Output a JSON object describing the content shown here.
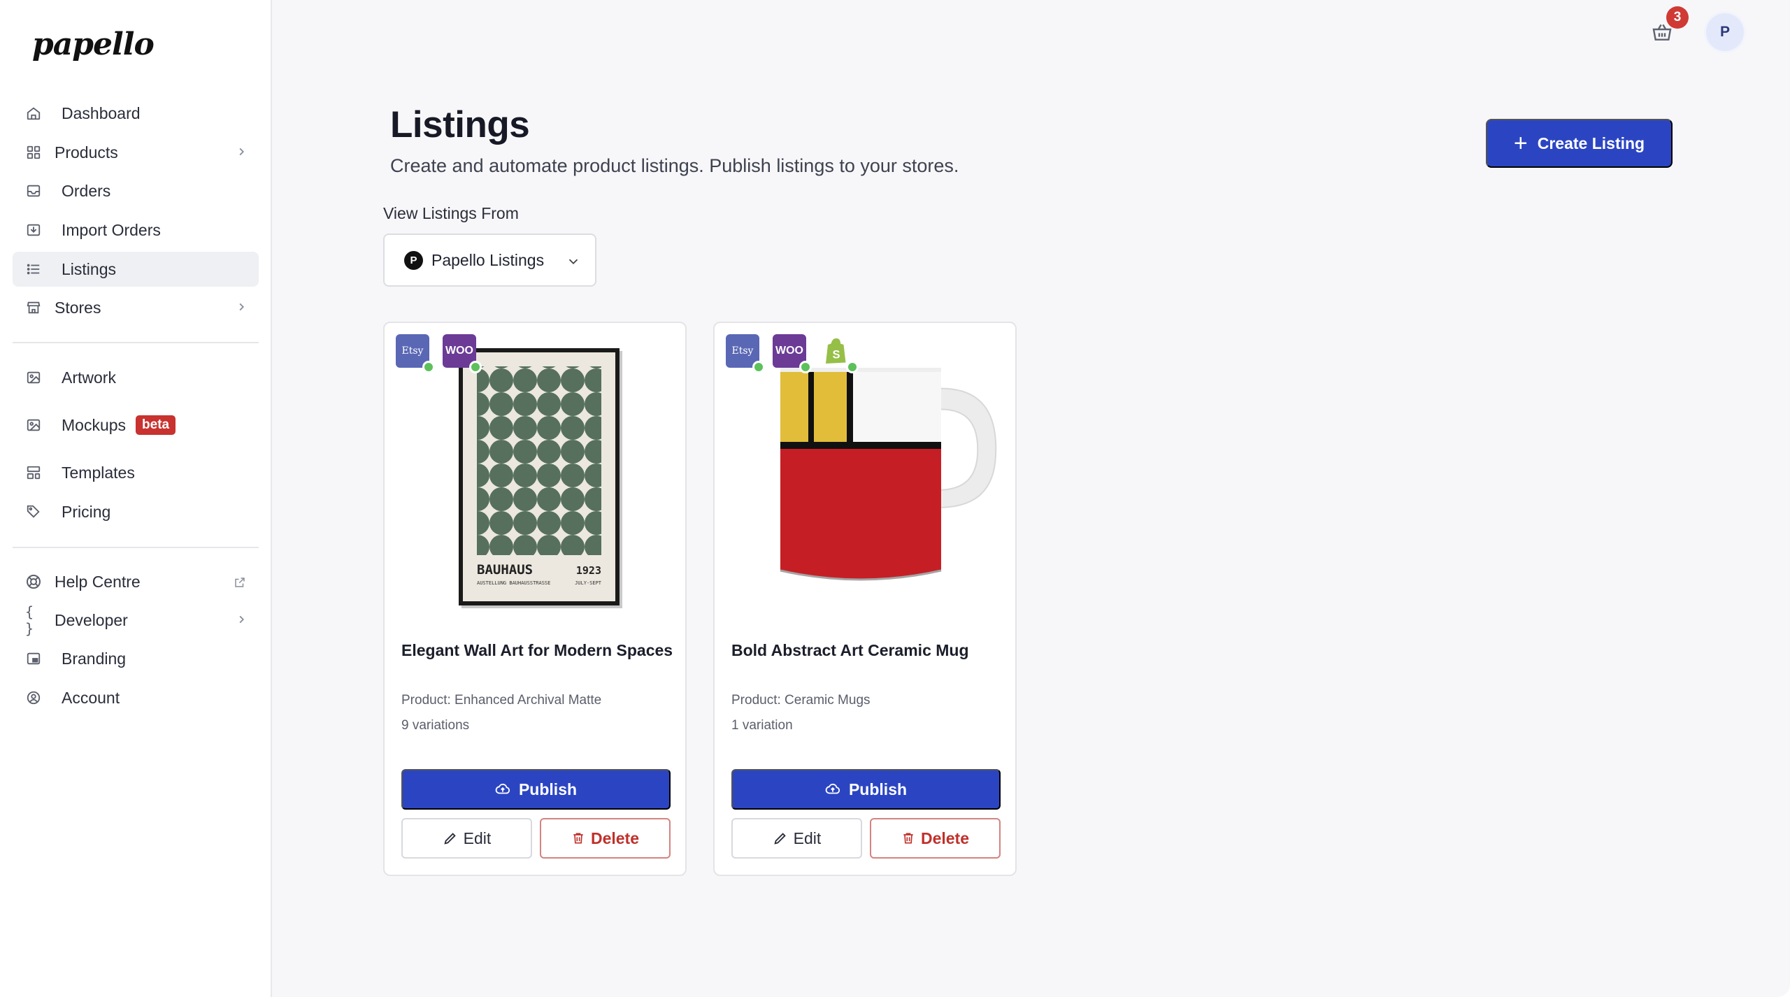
{
  "brand": {
    "logo": "papello"
  },
  "sidebar": {
    "items": [
      {
        "label": "Dashboard"
      },
      {
        "label": "Products"
      },
      {
        "label": "Orders"
      },
      {
        "label": "Import Orders"
      },
      {
        "label": "Listings"
      },
      {
        "label": "Stores"
      },
      {
        "label": "Artwork"
      },
      {
        "label": "Mockups",
        "badge": "beta"
      },
      {
        "label": "Templates"
      },
      {
        "label": "Pricing"
      },
      {
        "label": "Help Centre"
      },
      {
        "label": "Developer"
      },
      {
        "label": "Branding"
      },
      {
        "label": "Account"
      }
    ],
    "active": "Listings"
  },
  "header": {
    "cart_count": "3",
    "avatar_initial": "P"
  },
  "main": {
    "title": "Listings",
    "subtitle": "Create and automate product listings. Publish listings to your stores.",
    "create_button": "Create Listing",
    "view_label": "View Listings From",
    "view_select": {
      "value": "Papello Listings"
    }
  },
  "listings": [
    {
      "title": "Elegant Wall Art for Modern Spaces",
      "product": "Product: Enhanced Archival Matte",
      "variations": "9 variations",
      "stores": [
        "Etsy",
        "WOO"
      ],
      "poster": {
        "heading": "BAUHAUS",
        "year": "1923",
        "sub_left": "AUSTELLUNG BAUHAUSSTRASSE",
        "sub_right": "JULY-SEPT"
      },
      "publish": "Publish",
      "edit": "Edit",
      "delete": "Delete"
    },
    {
      "title": "Bold Abstract Art Ceramic Mug",
      "product": "Product: Ceramic Mugs",
      "variations": "1 variation",
      "stores": [
        "Etsy",
        "WOO",
        "Shopify"
      ],
      "publish": "Publish",
      "edit": "Edit",
      "delete": "Delete"
    }
  ],
  "colors": {
    "primary": "#2b45c2",
    "danger": "#c0302b",
    "badge": "#cf3a35",
    "etsy": "#5a67b5",
    "woo": "#6b3b96",
    "status_dot": "#5cc15a"
  }
}
